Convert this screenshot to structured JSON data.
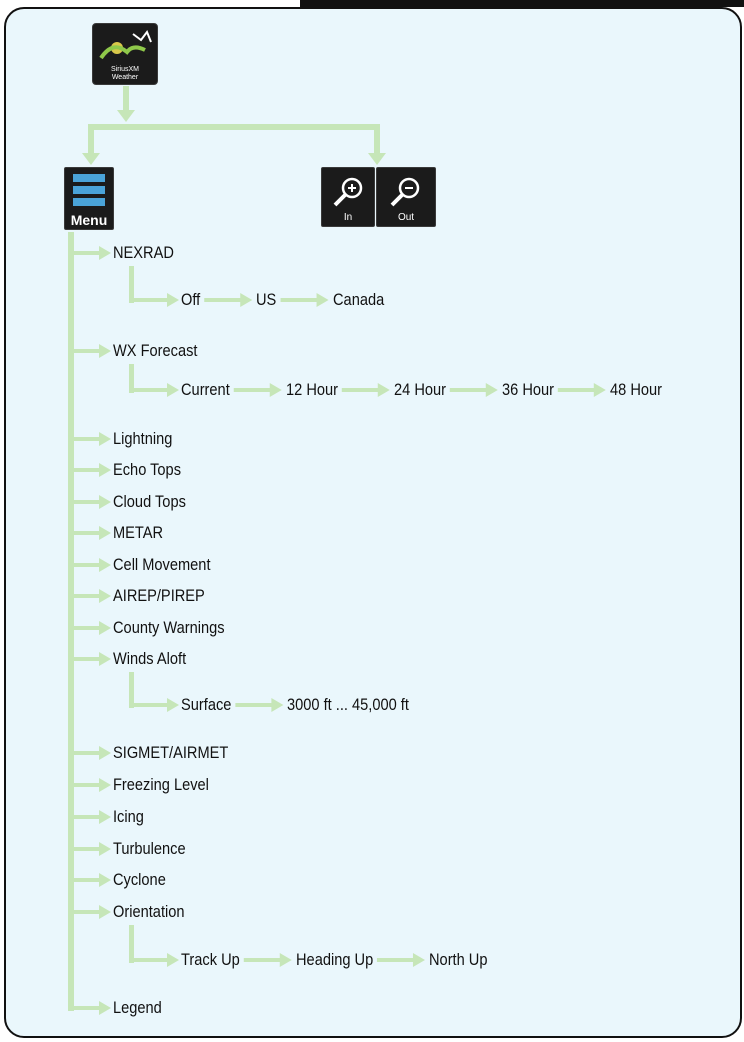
{
  "icons": {
    "smart_weather_caption": "SiriusXM Weather",
    "menu_caption": "Menu",
    "zoom_in_caption": "In",
    "zoom_out_caption": "Out"
  },
  "menu": {
    "items": [
      {
        "label": "NEXRAD",
        "children": [
          "Off",
          "US",
          "Canada"
        ]
      },
      {
        "label": "WX Forecast",
        "children": [
          "Current",
          "12 Hour",
          "24 Hour",
          "36 Hour",
          "48 Hour"
        ]
      },
      {
        "label": "Lightning"
      },
      {
        "label": "Echo Tops"
      },
      {
        "label": "Cloud Tops"
      },
      {
        "label": "METAR"
      },
      {
        "label": "Cell Movement"
      },
      {
        "label": "AIREP/PIREP"
      },
      {
        "label": "County Warnings"
      },
      {
        "label": "Winds Aloft",
        "children": [
          "Surface",
          "3000 ft ... 45,000 ft"
        ]
      },
      {
        "label": "SIGMET/AIRMET"
      },
      {
        "label": "Freezing Level"
      },
      {
        "label": "Icing"
      },
      {
        "label": "Turbulence"
      },
      {
        "label": "Cyclone"
      },
      {
        "label": "Orientation",
        "children": [
          "Track Up",
          "Heading Up",
          "North Up"
        ]
      },
      {
        "label": "Legend"
      }
    ]
  },
  "colors": {
    "connector": "#c6e6b8",
    "background": "#eaf7fc",
    "icon_bg": "#1b1b1b"
  }
}
